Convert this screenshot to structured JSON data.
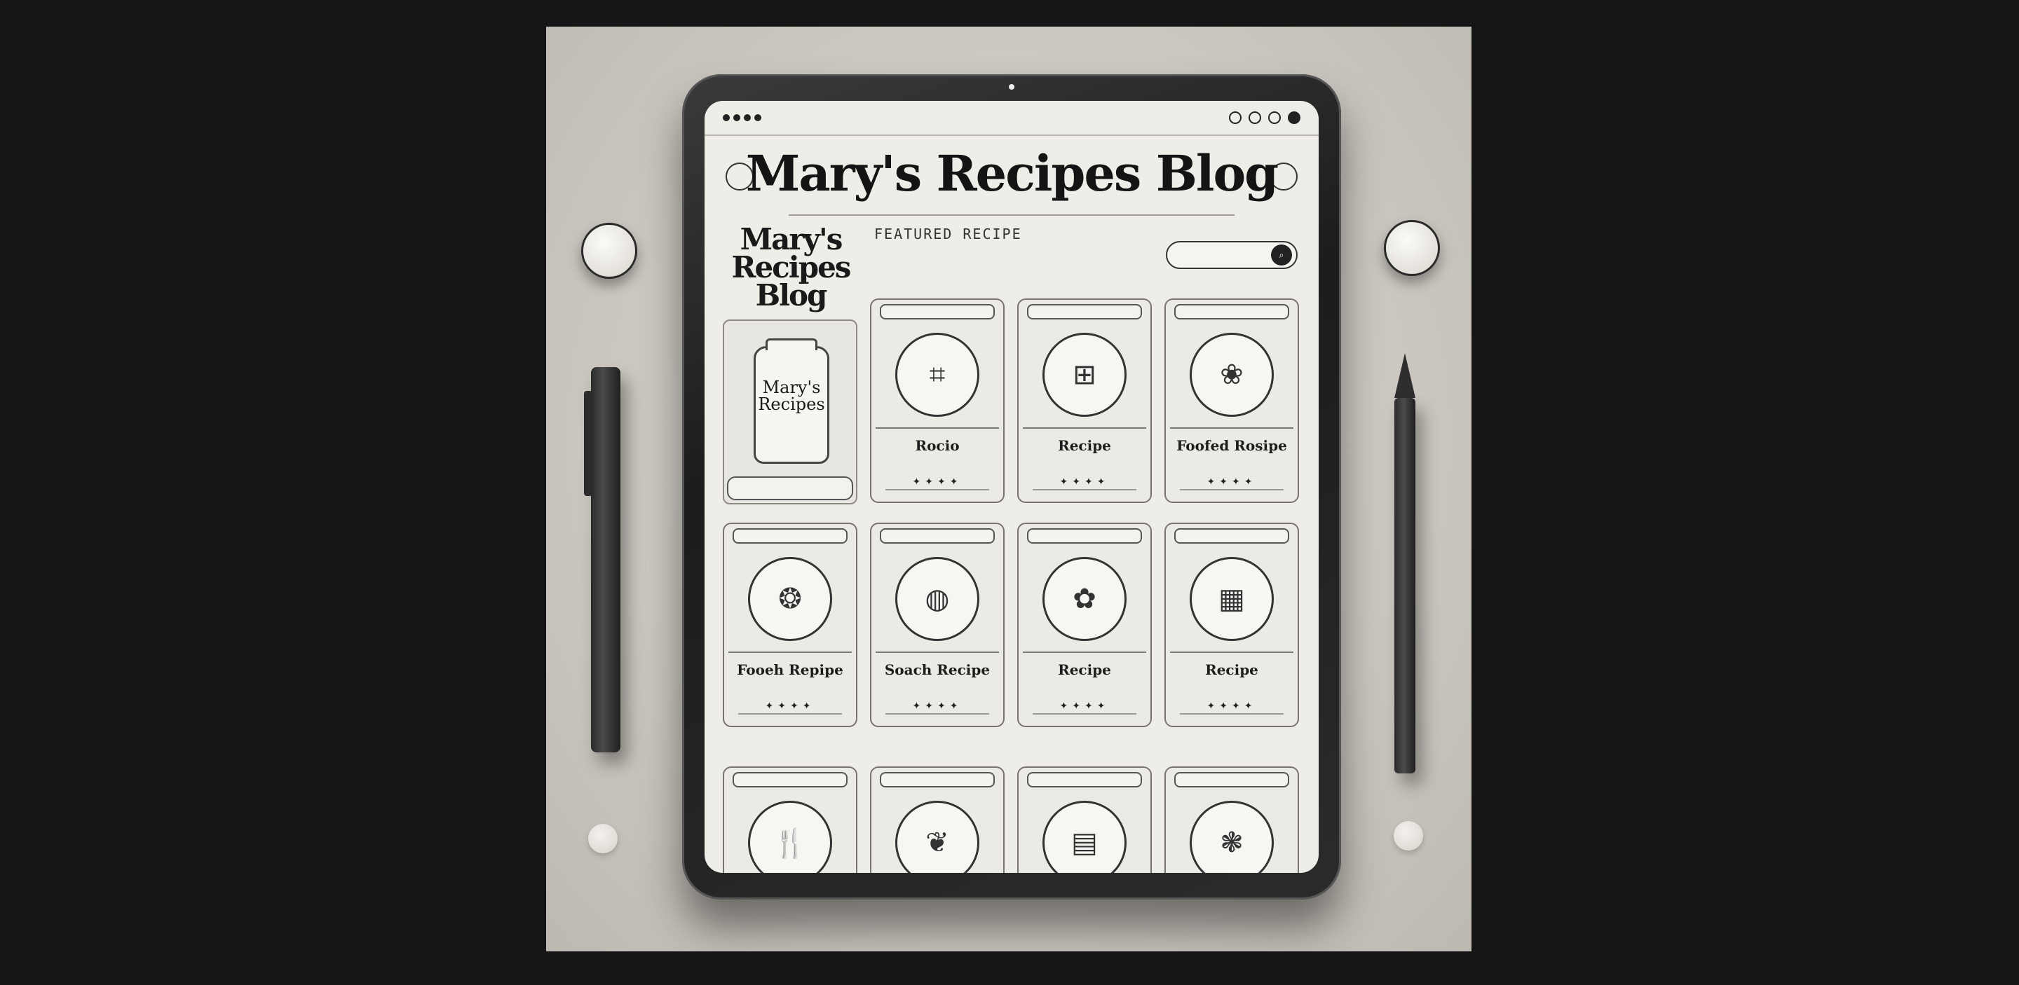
{
  "blog": {
    "title": "Mary's Recipes Blog",
    "side_logo": "Mary's Recipes Blog",
    "jar_label": "Mary's Recipes",
    "featured_label": "FEATURED RECIPE"
  },
  "recipes": [
    {
      "name": "Rocio"
    },
    {
      "name": "Recipe"
    },
    {
      "name": "Foofed Rosipe"
    },
    {
      "name": "Fooeh Repipe"
    },
    {
      "name": "Soach Recipe"
    },
    {
      "name": "Recipe"
    },
    {
      "name": "Recipe"
    }
  ]
}
